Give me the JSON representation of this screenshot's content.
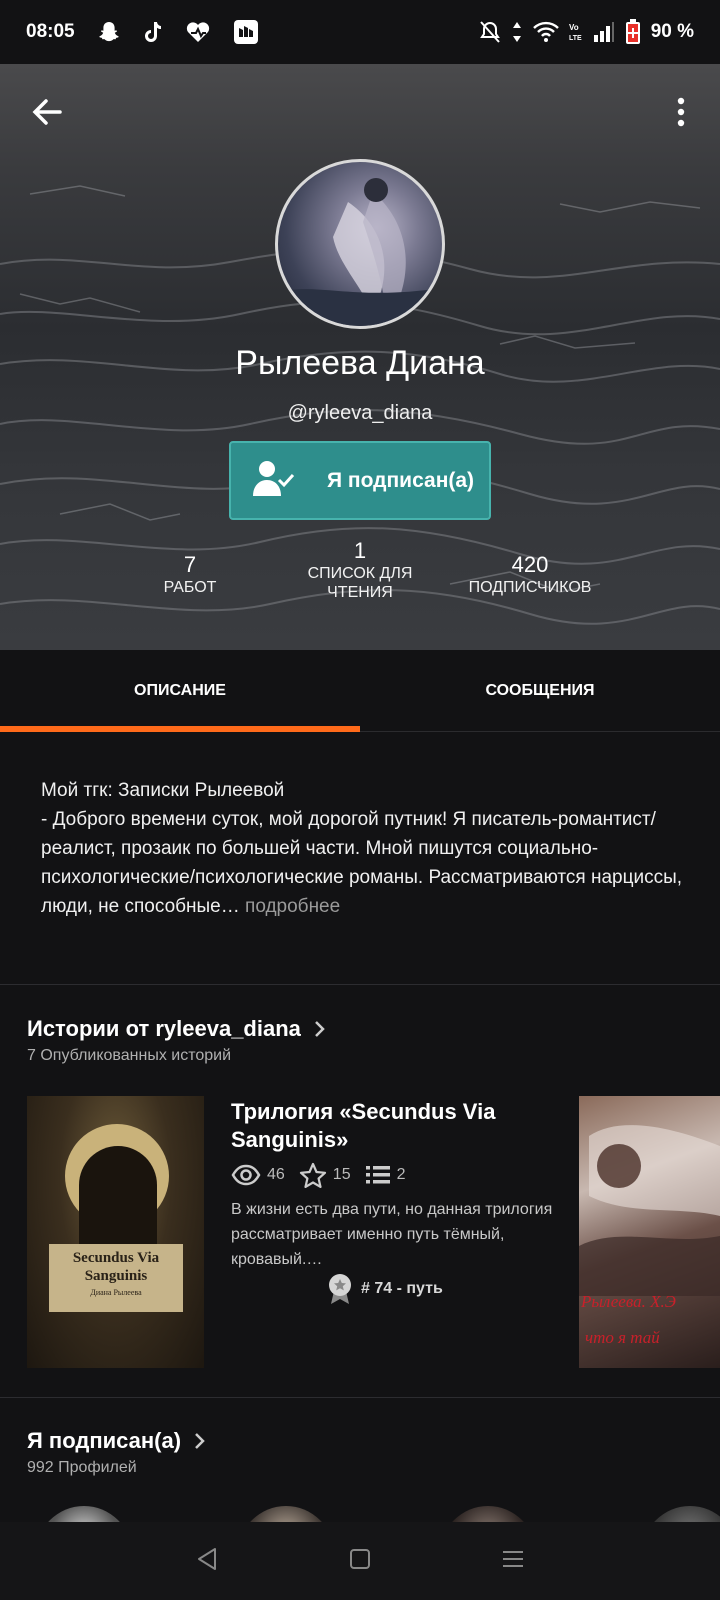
{
  "status_bar": {
    "time": "08:05",
    "battery": "90 %",
    "left_icons": [
      "snapchat-icon",
      "tiktok-icon",
      "heart-app-icon",
      "wattpad-icon"
    ],
    "right_icons": [
      "mute-icon",
      "data-arrows-icon",
      "wifi-icon",
      "volte-icon",
      "signal-icon",
      "battery-icon"
    ]
  },
  "profile": {
    "name": "Рылеева Диана",
    "handle": "@ryleeva_diana",
    "follow_label": "Я подписан(а)",
    "stats": [
      {
        "value": "7",
        "label": "РАБОТ"
      },
      {
        "value": "1",
        "label": "СПИСОК ДЛЯ ЧТЕНИЯ"
      },
      {
        "value": "420",
        "label": "ПОДПИСЧИКОВ"
      }
    ]
  },
  "tabs": [
    {
      "label": "ОПИСАНИЕ",
      "active": true
    },
    {
      "label": "СООБЩЕНИЯ",
      "active": false
    }
  ],
  "description": {
    "text": "Мой тгк: Записки Рылеевой\n- Доброго времени суток, мой дорогой путник! Я писатель-романтист/реалист, прозаик по большей части. Мной пишутся социально-психологические/психологические романы. Рассматриваются нарциссы, люди, не способные…",
    "more": " подробнее"
  },
  "stories": {
    "title": "Истории от ryleeva_diana",
    "subtitle": "7 Опубликованных историй",
    "items": [
      {
        "title": "Трилогия «Secundus Via Sanguinis»",
        "reads": "46",
        "votes": "15",
        "parts": "2",
        "description": "В жизни есть два пути, но данная трилогия рассматривает именно путь тёмный, кровавый.…",
        "rank": "# 74 - путь",
        "cover_title": "Secundus Via Sanguinis",
        "cover_author": "Диана Рылеева"
      }
    ],
    "next_cover_text_1": "Рылеева. Х.Э",
    "next_cover_text_2": "что я тай"
  },
  "following": {
    "title": "Я подписан(а)",
    "subtitle": "992 Профилей"
  },
  "colors": {
    "accent": "#ff6a1a",
    "follow_button": "#2e8e8c",
    "background": "#121214"
  }
}
